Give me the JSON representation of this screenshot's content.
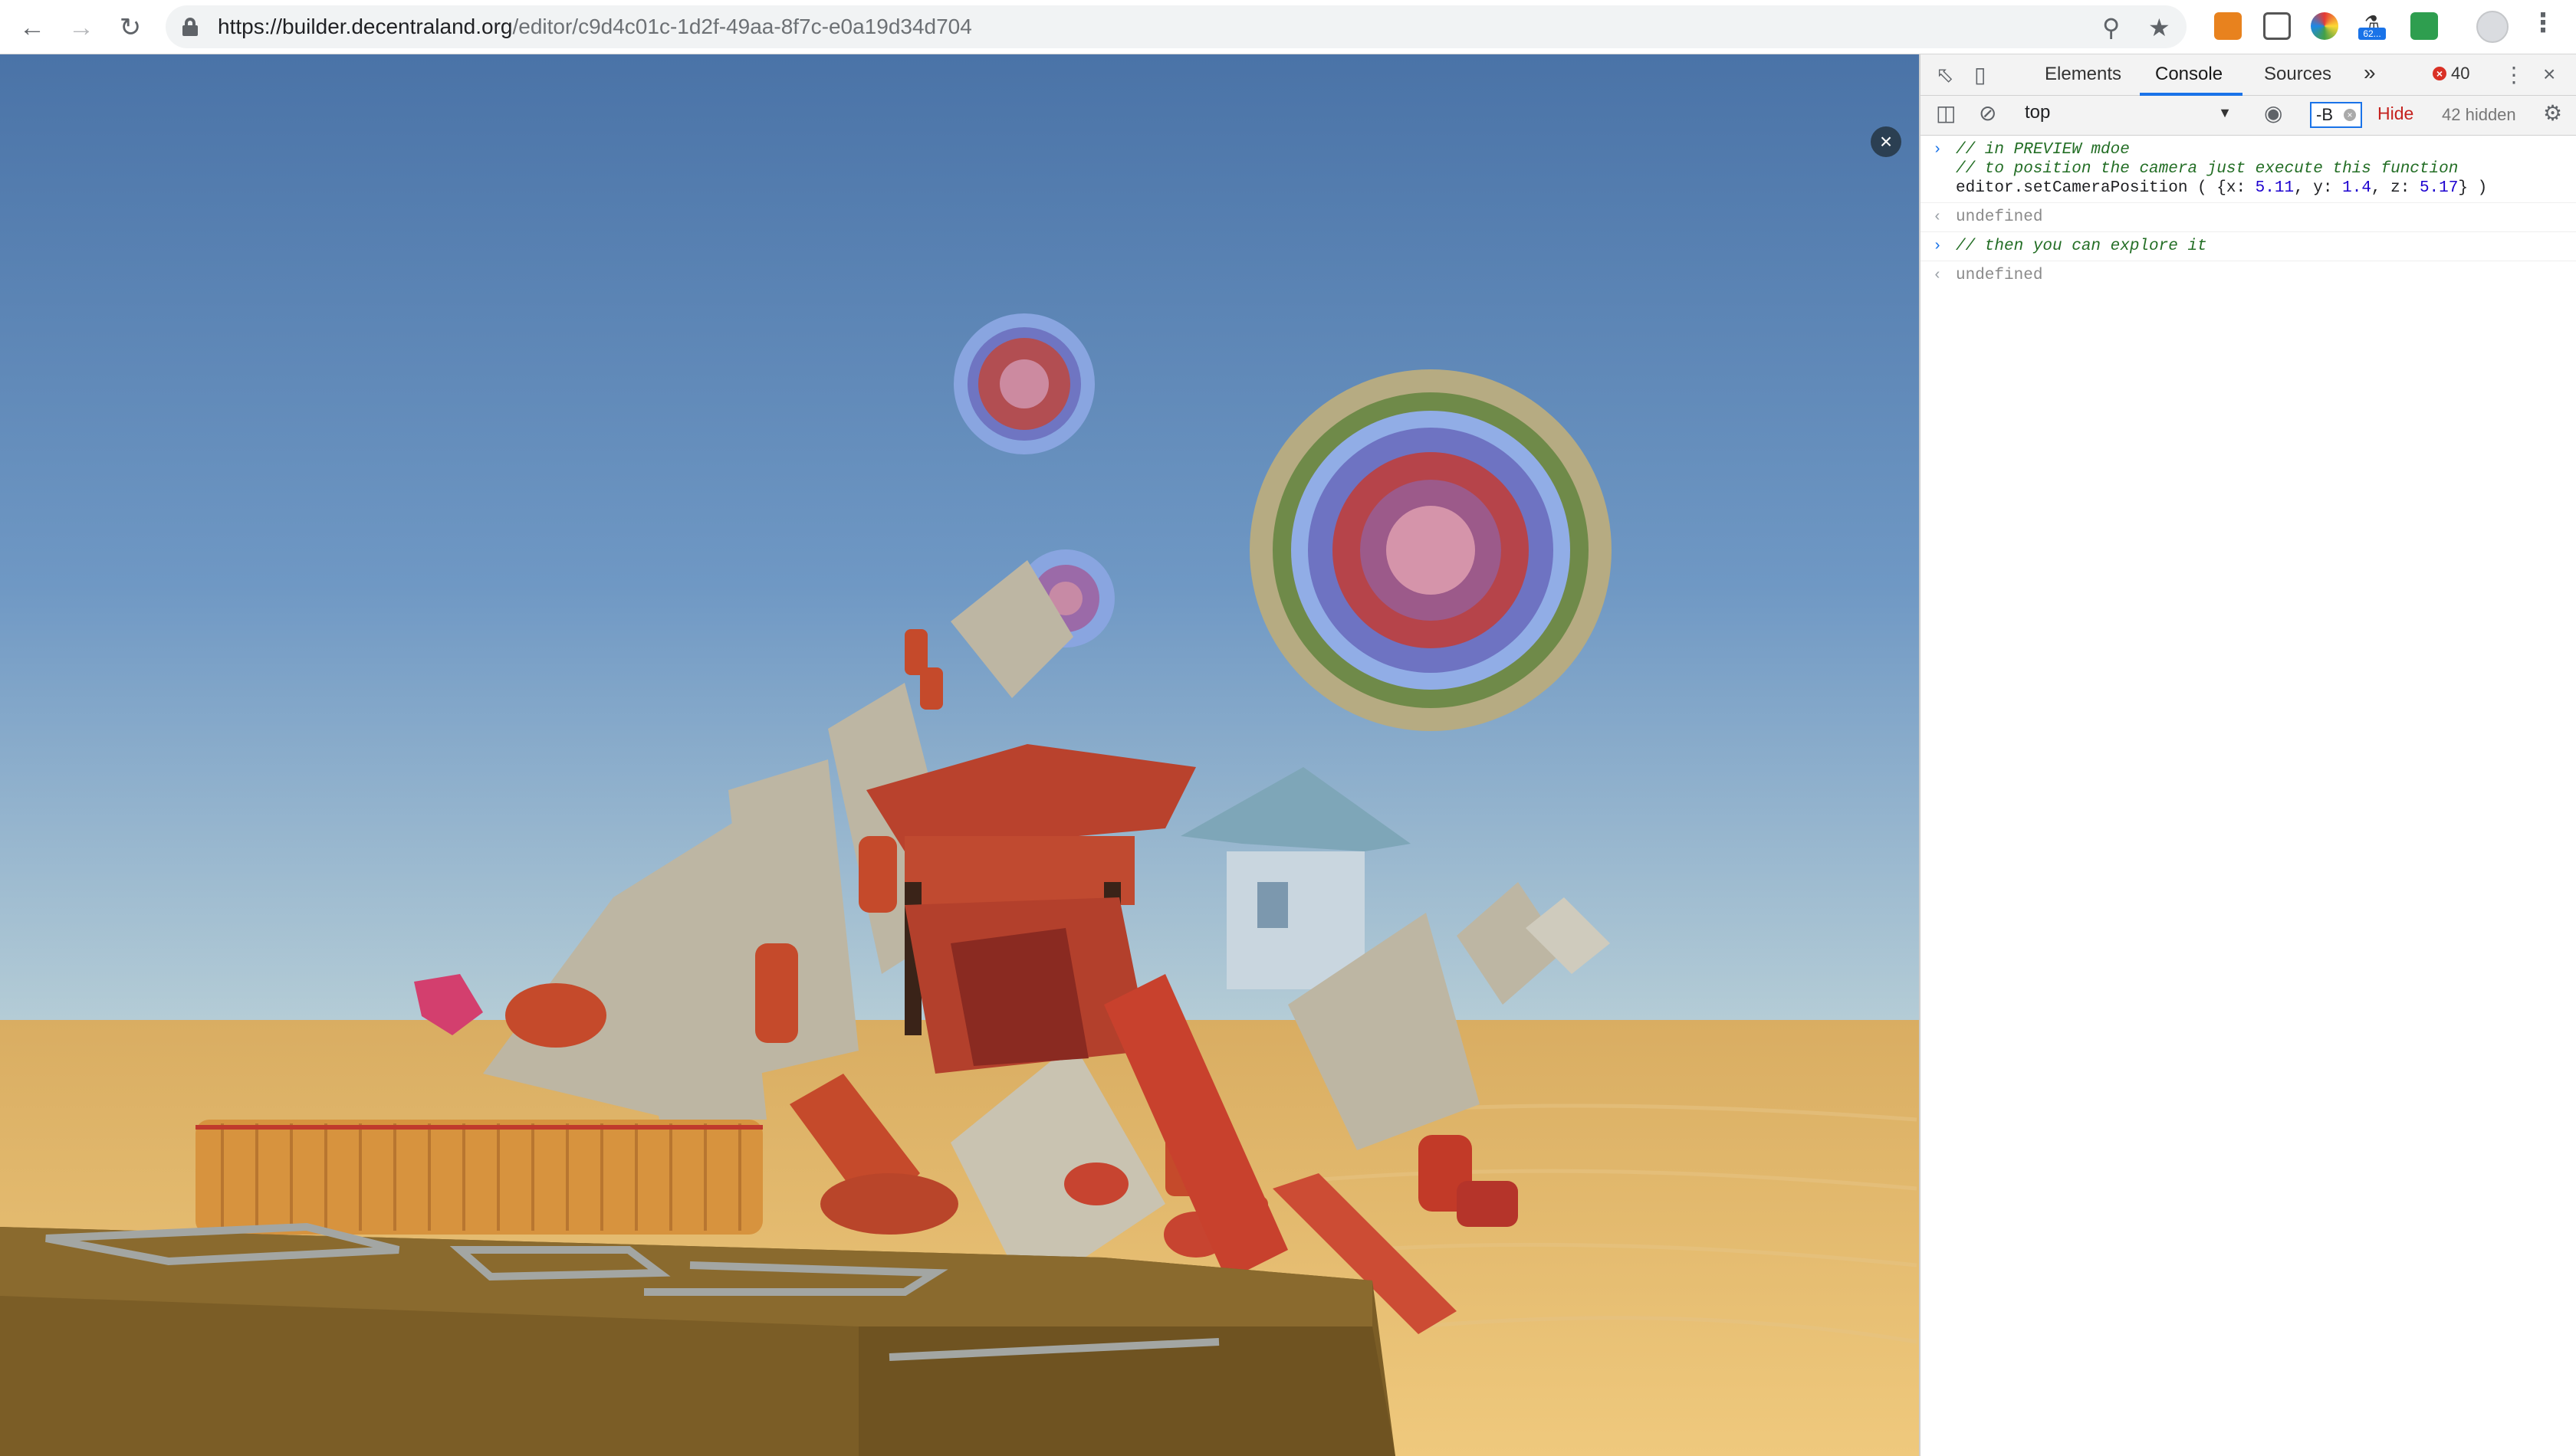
{
  "browser": {
    "url_host": "https://builder.decentraland.org",
    "url_path": "/editor/c9d4c01c-1d2f-49aa-8f7c-e0a19d34d704",
    "extension_badge": "62..."
  },
  "devtools": {
    "tabs": [
      "Elements",
      "Console",
      "Sources"
    ],
    "active_tab": "Console",
    "more_tabs": "»",
    "error_count": "40",
    "context": "top",
    "filter_value": "-B",
    "hide_label": "Hide",
    "hidden_count": "42 hidden",
    "console": {
      "block1_comment1": "// in PREVIEW mdoe",
      "block1_comment2": "// to position the camera just execute this function",
      "block1_code_prefix": "editor.setCameraPosition ( {x: ",
      "block1_x": "5.11",
      "block1_y_label": ", y: ",
      "block1_y": "1.4",
      "block1_z_label": ", z: ",
      "block1_z": "5.17",
      "block1_code_suffix": "} )",
      "result1": "undefined",
      "block2_comment": "// then you can explore it",
      "result2": "undefined"
    }
  },
  "icons": {
    "back": "back-arrow-icon",
    "forward": "forward-arrow-icon",
    "reload": "reload-icon",
    "zoom": "zoom-icon",
    "star": "bookmark-star-icon"
  },
  "colors": {
    "sky_top": "#4b74a8",
    "sky_bottom": "#a9c3d4",
    "sand": "#e3b66a",
    "platform": "#7d5e27",
    "accent_blue": "#1a73e8"
  }
}
